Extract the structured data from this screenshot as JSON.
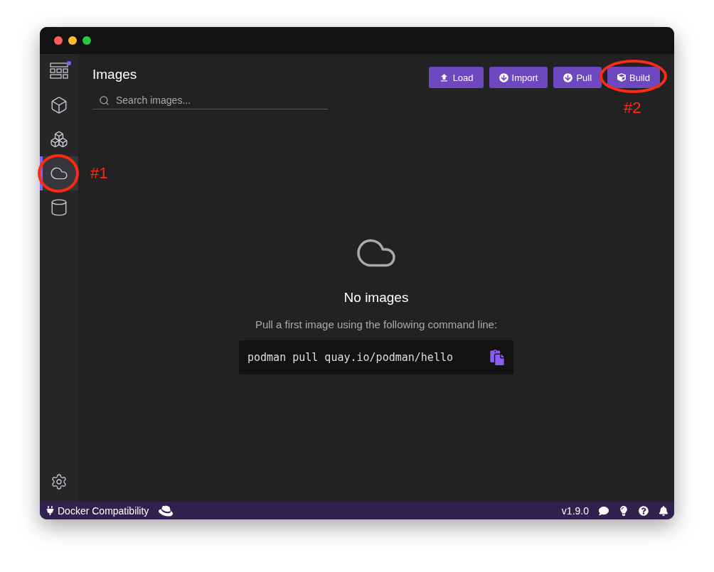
{
  "sidebar": {
    "items": [
      {
        "kind": "dashboard",
        "selected": false,
        "badge": true
      },
      {
        "kind": "containers",
        "selected": false,
        "badge": false
      },
      {
        "kind": "pods",
        "selected": false,
        "badge": false
      },
      {
        "kind": "images",
        "selected": true,
        "badge": false
      },
      {
        "kind": "volumes",
        "selected": false,
        "badge": false
      }
    ],
    "settings": {
      "kind": "settings"
    }
  },
  "page": {
    "title": "Images",
    "search": {
      "placeholder": "Search images..."
    },
    "buttons": [
      {
        "kind": "load",
        "label": "Load"
      },
      {
        "kind": "import",
        "label": "Import"
      },
      {
        "kind": "pull",
        "label": "Pull"
      },
      {
        "kind": "build",
        "label": "Build"
      }
    ]
  },
  "empty_state": {
    "title": "No images",
    "message": "Pull a first image using the following command line:",
    "command": "podman pull quay.io/podman/hello"
  },
  "status_bar": {
    "left": [
      {
        "kind": "plug",
        "label": "Docker Compatibility"
      },
      {
        "kind": "redhat"
      }
    ],
    "version": "v1.9.0",
    "right": [
      {
        "kind": "comment"
      },
      {
        "kind": "lightbulb"
      },
      {
        "kind": "help"
      },
      {
        "kind": "bell"
      }
    ]
  },
  "annotations": [
    {
      "label": "#1"
    },
    {
      "label": "#2"
    }
  ]
}
